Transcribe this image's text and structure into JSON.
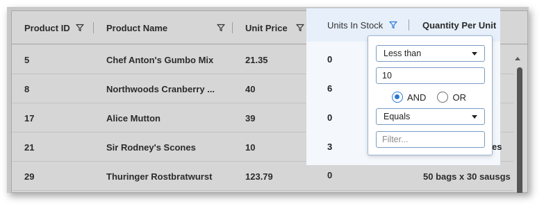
{
  "grid": {
    "columns": [
      {
        "label": "Product ID"
      },
      {
        "label": "Product Name"
      },
      {
        "label": "Unit Price"
      },
      {
        "label": "Units In Stock"
      },
      {
        "label": "Quantity Per Unit"
      }
    ],
    "rows": [
      {
        "id": "5",
        "name": "Chef Anton's Gumbo Mix",
        "price": "21.35",
        "stock": "0",
        "qty": ""
      },
      {
        "id": "8",
        "name": "Northwoods Cranberry ...",
        "price": "40",
        "stock": "6",
        "qty": ""
      },
      {
        "id": "17",
        "name": "Alice Mutton",
        "price": "39",
        "stock": "0",
        "qty": ""
      },
      {
        "id": "21",
        "name": "Sir Rodney's Scones",
        "price": "10",
        "stock": "3",
        "qty": "es"
      },
      {
        "id": "29",
        "name": "Thuringer Rostbratwurst",
        "price": "123.79",
        "stock": "0",
        "qty": "50 bags x 30 sausgs"
      }
    ]
  },
  "filter_popup": {
    "operator1": "Less than",
    "value1": "10",
    "logic_and": "AND",
    "logic_or": "OR",
    "logic_selected": "AND",
    "operator2": "Equals",
    "value2_placeholder": "Filter..."
  },
  "colors": {
    "active_filter": "#2a78d6",
    "accent": "#2a78d6"
  },
  "icons": {
    "column_filter": "funnel-icon",
    "dropdown": "caret-down-icon"
  }
}
